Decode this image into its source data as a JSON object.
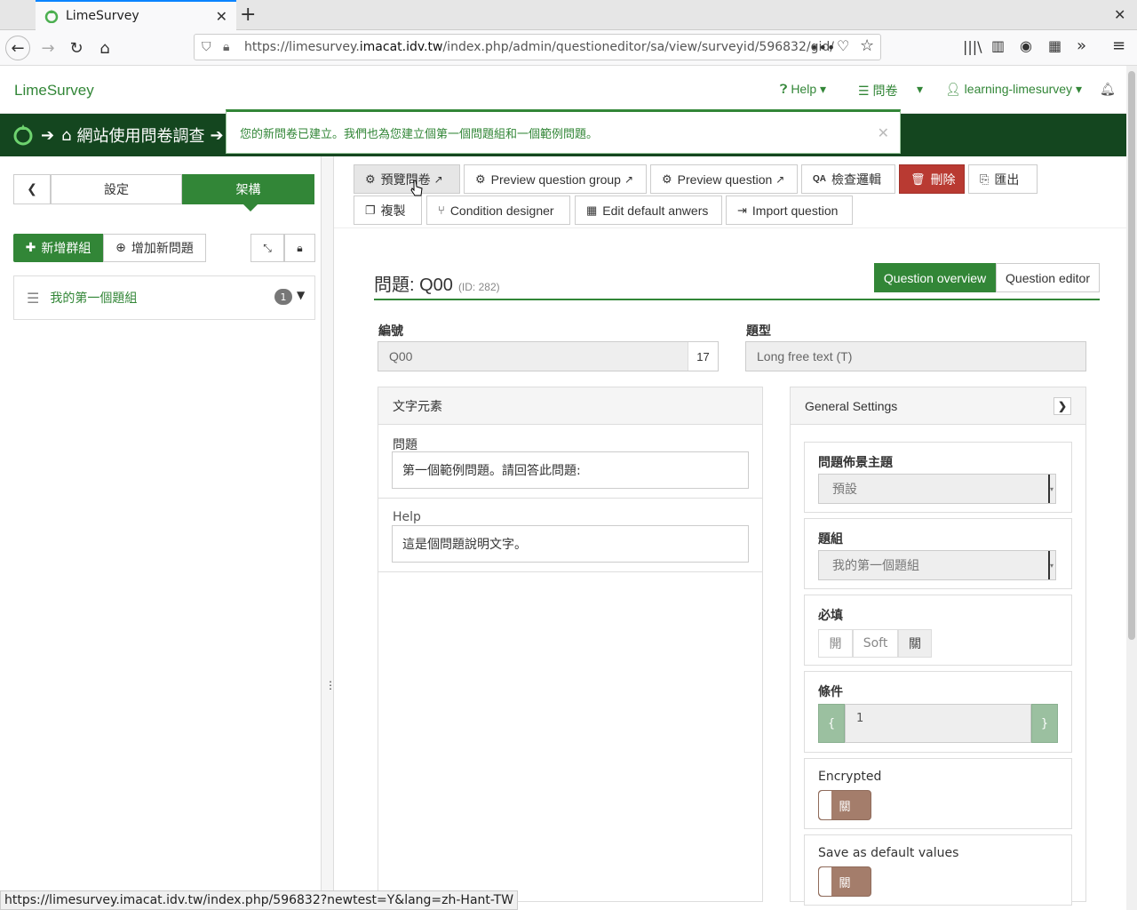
{
  "browser": {
    "tab_title": "LimeSurvey",
    "url_prefix": "https://limesurvey.",
    "url_host": "imacat.idv.tw",
    "url_path": "/index.php/admin/questioneditor/sa/view/surveyid/596832/gid/",
    "status_url": "https://limesurvey.imacat.idv.tw/index.php/596832?newtest=Y&lang=zh-Hant-TW"
  },
  "header": {
    "brand": "LimeSurvey",
    "help_label": "Help",
    "surveys_label": "問卷",
    "user_label": "learning-limesurvey"
  },
  "breadcrumb": {
    "survey_title": "網站使用問卷調查"
  },
  "alert": {
    "message": "您的新問卷已建立。我們也為您建立個第一個問題組和一個範例問題。"
  },
  "sidebar": {
    "tab_settings": "設定",
    "tab_structure": "架構",
    "add_group": "新增群組",
    "add_question": "增加新問題",
    "group_name": "我的第一個題組",
    "group_count": "1"
  },
  "toolbar": {
    "preview_survey": "預覽問卷",
    "preview_group": "Preview question group",
    "preview_question": "Preview question",
    "check_logic": "檢查邏輯",
    "delete": "刪除",
    "export": "匯出",
    "copy": "複製",
    "condition_designer": "Condition designer",
    "edit_default": "Edit default anwers",
    "import_question": "Import question"
  },
  "question": {
    "title_prefix": "問題:",
    "code": "Q00",
    "id_label": "(ID: 282)",
    "overview_btn": "Question overview",
    "editor_btn": "Question editor",
    "code_label": "編號",
    "code_value": "Q00",
    "code_counter": "17",
    "type_label": "題型",
    "type_value": "Long free text (T)"
  },
  "text_panel": {
    "title": "文字元素",
    "question_label": "問題",
    "question_text": "第一個範例問題。請回答此問題:",
    "help_label": "Help",
    "help_text": "這是個問題說明文字。"
  },
  "settings_panel": {
    "title": "General Settings",
    "theme_label": "問題佈景主題",
    "theme_value": "預設",
    "group_label": "題組",
    "group_value": "我的第一個題組",
    "mandatory_label": "必填",
    "mandatory_on": "開",
    "mandatory_soft": "Soft",
    "mandatory_off": "關",
    "condition_label": "條件",
    "condition_value": "1",
    "brace_open": "{",
    "brace_close": "}",
    "encrypted_label": "Encrypted",
    "encrypted_value": "關",
    "default_label": "Save as default values",
    "default_value": "關"
  },
  "colors": {
    "brand_green": "#328637",
    "dark_green": "#14461f",
    "danger": "#b93a32",
    "toggle_off": "#a47d6b"
  }
}
